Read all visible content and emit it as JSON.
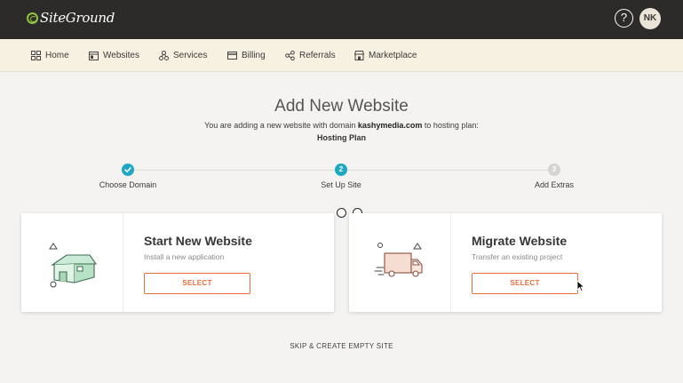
{
  "brand": {
    "name": "SiteGround",
    "accent": "#8ec63f"
  },
  "header": {
    "help_icon": "?",
    "avatar_initials": "NK"
  },
  "nav": {
    "items": [
      {
        "label": "Home",
        "icon": "grid-icon"
      },
      {
        "label": "Websites",
        "icon": "browser-icon"
      },
      {
        "label": "Services",
        "icon": "nodes-icon"
      },
      {
        "label": "Billing",
        "icon": "card-icon"
      },
      {
        "label": "Referrals",
        "icon": "share-icon"
      },
      {
        "label": "Marketplace",
        "icon": "store-icon"
      }
    ]
  },
  "page": {
    "title": "Add New Website",
    "subtitle_prefix": "You are adding a new website with domain ",
    "domain": "kashymedia.com",
    "subtitle_suffix": " to hosting plan:",
    "plan": "Hosting Plan"
  },
  "steps": [
    {
      "number": "1",
      "label": "Choose Domain",
      "state": "done",
      "color": "#1ea8c3"
    },
    {
      "number": "2",
      "label": "Set Up Site",
      "state": "active",
      "color": "#1ea8c3"
    },
    {
      "number": "3",
      "label": "Add Extras",
      "state": "pending",
      "color": "#d6d4d0"
    }
  ],
  "cards": [
    {
      "title": "Start New Website",
      "description": "Install a new application",
      "button": "SELECT",
      "illustration": "house-icon"
    },
    {
      "title": "Migrate Website",
      "description": "Transfer an existing project",
      "button": "SELECT",
      "illustration": "truck-icon"
    }
  ],
  "skip_label": "SKIP & CREATE EMPTY SITE",
  "colors": {
    "button": "#e96c3c",
    "step_active": "#1ea8c3",
    "topbar": "#2d2b2a",
    "navbar": "#f7f1e1"
  }
}
